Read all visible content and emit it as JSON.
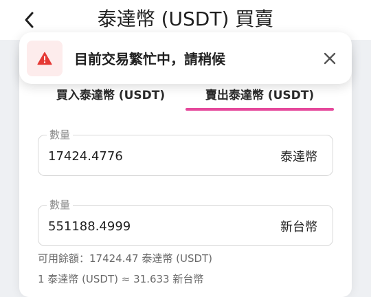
{
  "header": {
    "title": "泰達幣 (USDT) 買賣",
    "back_icon": "chevron-left-icon"
  },
  "toast": {
    "message": "目前交易繁忙中，請稍候",
    "icon": "warning-triangle-icon",
    "icon_color": "#e53935",
    "close_icon": "close-icon"
  },
  "tabs": [
    {
      "label": "買入泰達幣 (USDT)",
      "active": false
    },
    {
      "label": "賣出泰達幣 (USDT)",
      "active": true
    }
  ],
  "accent_color": "#e5489b",
  "form": {
    "crypto_field": {
      "label": "數量",
      "value": "17424.4776",
      "unit": "泰達幣"
    },
    "fiat_field": {
      "label": "數量",
      "value": "551188.4999",
      "unit": "新台幣"
    },
    "available_balance": "可用餘額：17424.47 泰達幣 (USDT)",
    "exchange_rate": "1 泰達幣 (USDT) ≈ 31.633 新台幣"
  }
}
